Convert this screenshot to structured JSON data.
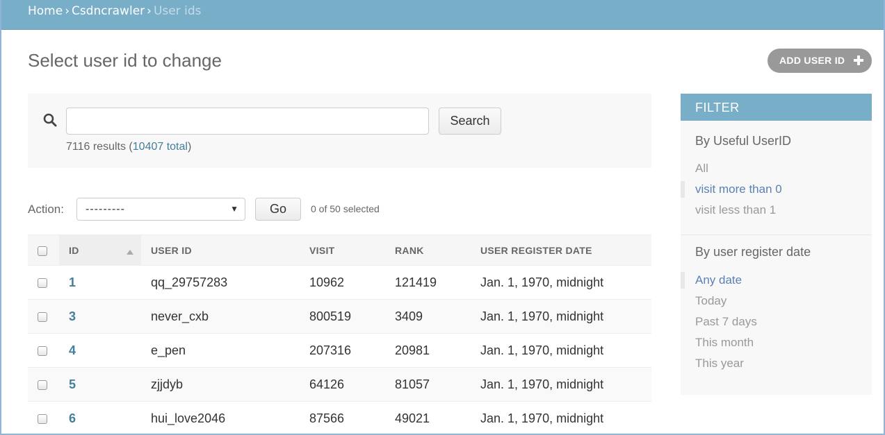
{
  "breadcrumbs": {
    "home": "Home",
    "app": "Csdncrawler",
    "current": "User ids",
    "separator": "›"
  },
  "page": {
    "title": "Select user id to change",
    "add_button": "ADD USER ID"
  },
  "search": {
    "value": "",
    "button": "Search",
    "result_count": "7116 results",
    "total_link": "10407 total"
  },
  "actions": {
    "label": "Action:",
    "selected_value": "---------",
    "go_button": "Go",
    "selected_count": "0 of 50 selected"
  },
  "table": {
    "columns": [
      "ID",
      "USER ID",
      "VISIT",
      "RANK",
      "USER REGISTER DATE"
    ],
    "sorted_column": "ID",
    "rows": [
      {
        "id": "1",
        "user_id": "qq_29757283",
        "visit": "10962",
        "rank": "121419",
        "date": "Jan. 1, 1970, midnight"
      },
      {
        "id": "3",
        "user_id": "never_cxb",
        "visit": "800519",
        "rank": "3409",
        "date": "Jan. 1, 1970, midnight"
      },
      {
        "id": "4",
        "user_id": "e_pen",
        "visit": "207316",
        "rank": "20981",
        "date": "Jan. 1, 1970, midnight"
      },
      {
        "id": "5",
        "user_id": "zjjdyb",
        "visit": "64126",
        "rank": "81057",
        "date": "Jan. 1, 1970, midnight"
      },
      {
        "id": "6",
        "user_id": "hui_love2046",
        "visit": "87566",
        "rank": "49021",
        "date": "Jan. 1, 1970, midnight"
      }
    ]
  },
  "filter": {
    "title": "FILTER",
    "groups": [
      {
        "title": "By Useful UserID",
        "options": [
          "All",
          "visit more than 0",
          "visit less than 1"
        ],
        "selected": "visit more than 0"
      },
      {
        "title": "By user register date",
        "options": [
          "Any date",
          "Today",
          "Past 7 days",
          "This month",
          "This year"
        ],
        "selected": "Any date"
      }
    ]
  },
  "colors": {
    "header_bg": "#79aec8",
    "link": "#447e9b",
    "filter_selected": "#5b80b2",
    "add_button_bg": "#999999"
  }
}
